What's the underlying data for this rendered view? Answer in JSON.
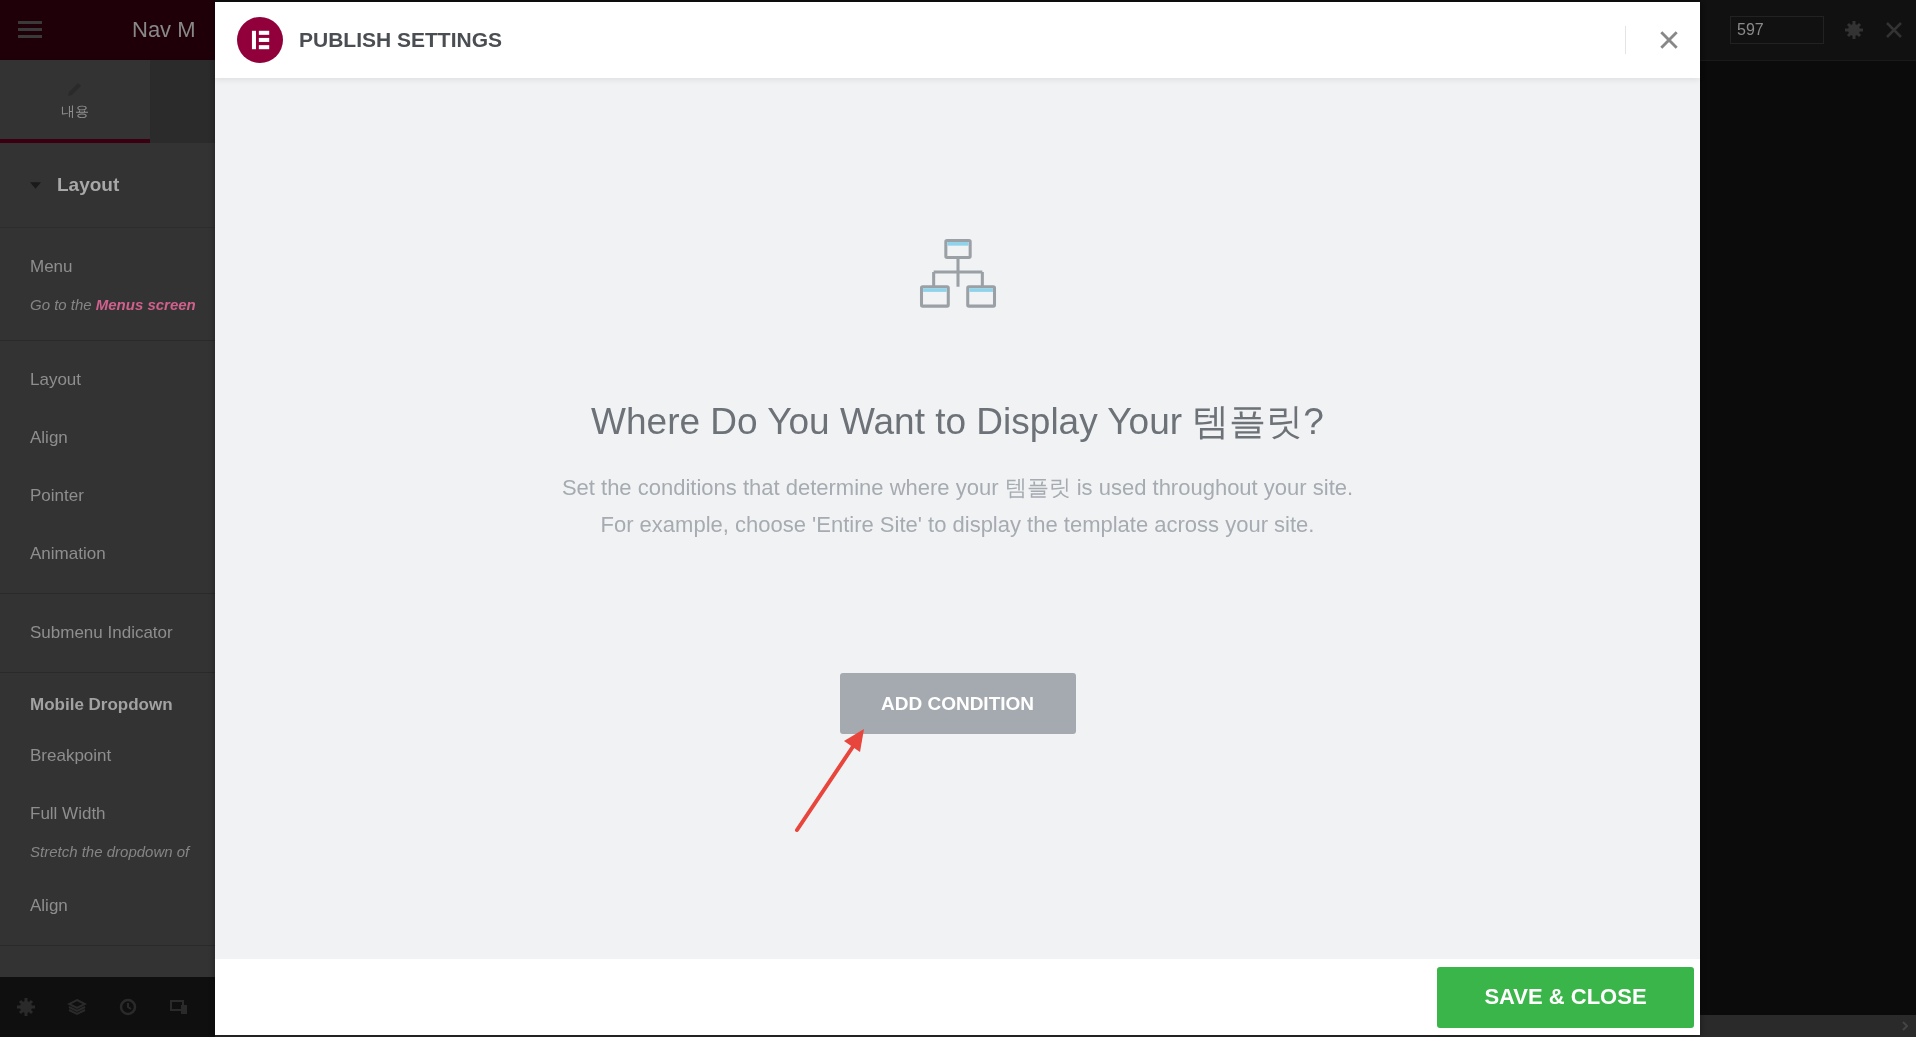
{
  "editor_panel": {
    "title": "Nav M",
    "tabs": [
      {
        "label": "내용",
        "selected": true
      }
    ],
    "section": {
      "title": "Layout",
      "expanded": true
    },
    "groups": [
      {
        "items": [
          {
            "kind": "control",
            "label": "Menu"
          },
          {
            "kind": "note",
            "text": "Go to the",
            "link": "Menus screen"
          }
        ]
      },
      {
        "items": [
          {
            "kind": "control",
            "label": "Layout"
          },
          {
            "kind": "control",
            "label": "Align"
          },
          {
            "kind": "control",
            "label": "Pointer"
          },
          {
            "kind": "control",
            "label": "Animation"
          }
        ]
      },
      {
        "items": [
          {
            "kind": "control",
            "label": "Submenu Indicator"
          }
        ]
      },
      {
        "items": [
          {
            "kind": "heading",
            "label": "Mobile Dropdown"
          },
          {
            "kind": "control",
            "label": "Breakpoint"
          },
          {
            "kind": "control",
            "label": "Full Width"
          },
          {
            "kind": "note",
            "text": "Stretch the dropdown of"
          },
          {
            "kind": "control",
            "label": "Align"
          }
        ]
      }
    ]
  },
  "preview_bar": {
    "width_value": "597"
  },
  "dialog": {
    "title": "PUBLISH SETTINGS",
    "heading": "Where Do You Want to Display Your 템플릿?",
    "description": [
      "Set the conditions that determine where your 템플릿 is used throughout your site.",
      "For example, choose 'Entire Site' to display the template across your site."
    ],
    "add_button": "ADD CONDITION",
    "save_button": "SAVE & CLOSE"
  }
}
